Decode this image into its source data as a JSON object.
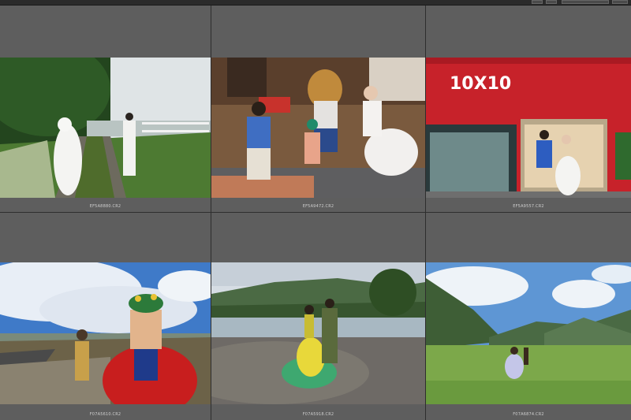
{
  "thumbnails": [
    {
      "filename": "EF5A8880.CR2",
      "scene": "wedding-couple-grass-path"
    },
    {
      "filename": "EF5A9472.CR2",
      "scene": "wedding-couple-teddy-bear"
    },
    {
      "filename": "EF5A9557.CR2",
      "scene": "wedding-couple-red-storefront",
      "sign": "10X10"
    },
    {
      "filename": "F07A5610.CR2",
      "scene": "woman-in-red-traditional-dress"
    },
    {
      "filename": "F07A5918.CR2",
      "scene": "couple-yellow-green-gown-riverbed"
    },
    {
      "filename": "F07A6874.CR2",
      "scene": "couple-mountain-meadow"
    }
  ]
}
